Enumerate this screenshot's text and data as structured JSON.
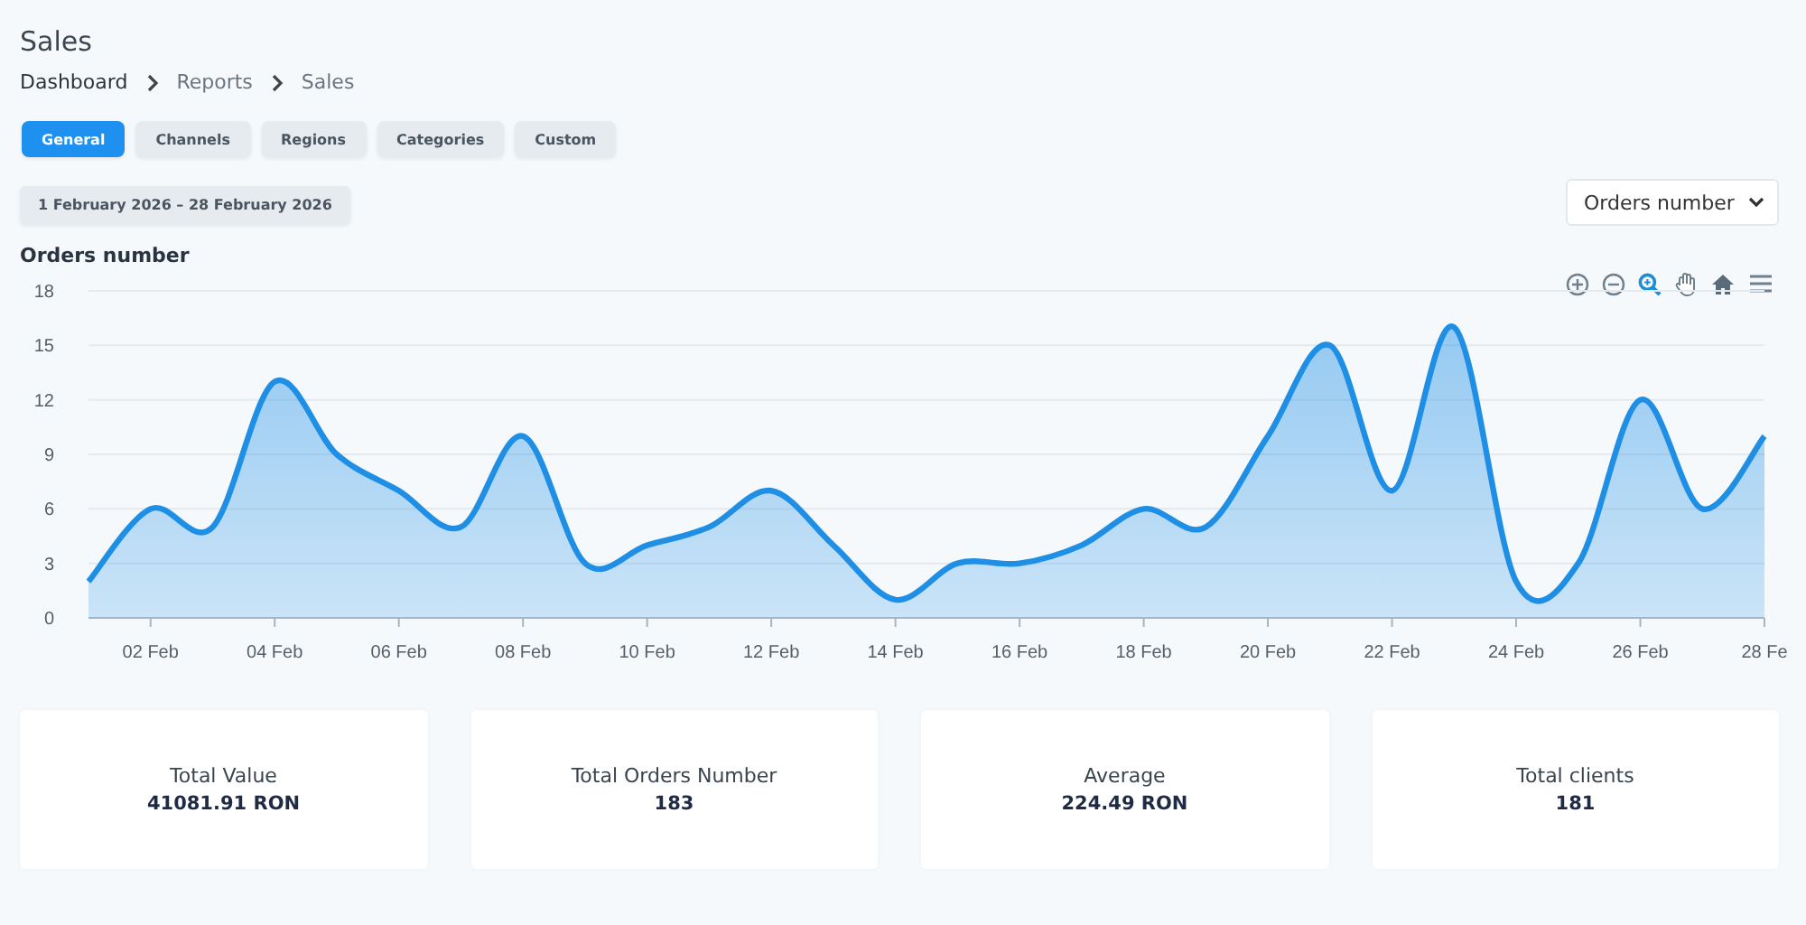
{
  "page": {
    "title": "Sales"
  },
  "breadcrumbs": [
    "Dashboard",
    "Reports",
    "Sales"
  ],
  "tabs": [
    {
      "label": "General",
      "selected": true
    },
    {
      "label": "Channels",
      "selected": false
    },
    {
      "label": "Regions",
      "selected": false
    },
    {
      "label": "Categories",
      "selected": false
    },
    {
      "label": "Custom",
      "selected": false
    }
  ],
  "date_range": "1 February 2026 – 28 February 2026",
  "metric_select": {
    "value": "Orders number"
  },
  "chart": {
    "chart_data": {
      "type": "area",
      "title": "Orders number",
      "categories": [
        null,
        "02 Feb",
        null,
        "04 Feb",
        null,
        "06 Feb",
        null,
        "08 Feb",
        null,
        "10 Feb",
        null,
        "12 Feb",
        null,
        "14 Feb",
        null,
        "16 Feb",
        null,
        "18 Feb",
        null,
        "20 Feb",
        null,
        "22 Feb",
        null,
        "24 Feb",
        null,
        "26 Feb",
        null,
        "28 Fe"
      ],
      "series": [
        {
          "color": "#1f8fe5",
          "values": [
            2,
            6,
            5,
            13,
            9,
            7,
            5,
            10,
            3,
            4,
            5,
            7,
            4,
            1,
            3,
            3,
            4,
            6,
            5,
            10,
            15,
            7,
            16,
            2,
            3,
            12,
            6,
            10
          ]
        }
      ],
      "ylim": [
        0,
        18
      ],
      "grid": true,
      "yticks": [
        0,
        3,
        6,
        9,
        12,
        15,
        18
      ]
    }
  },
  "stats": [
    {
      "label": "Total Value",
      "value": "41081.91 RON"
    },
    {
      "label": "Total Orders Number",
      "value": "183"
    },
    {
      "label": "Average",
      "value": "224.49 RON"
    },
    {
      "label": "Total clients",
      "value": "181"
    }
  ]
}
